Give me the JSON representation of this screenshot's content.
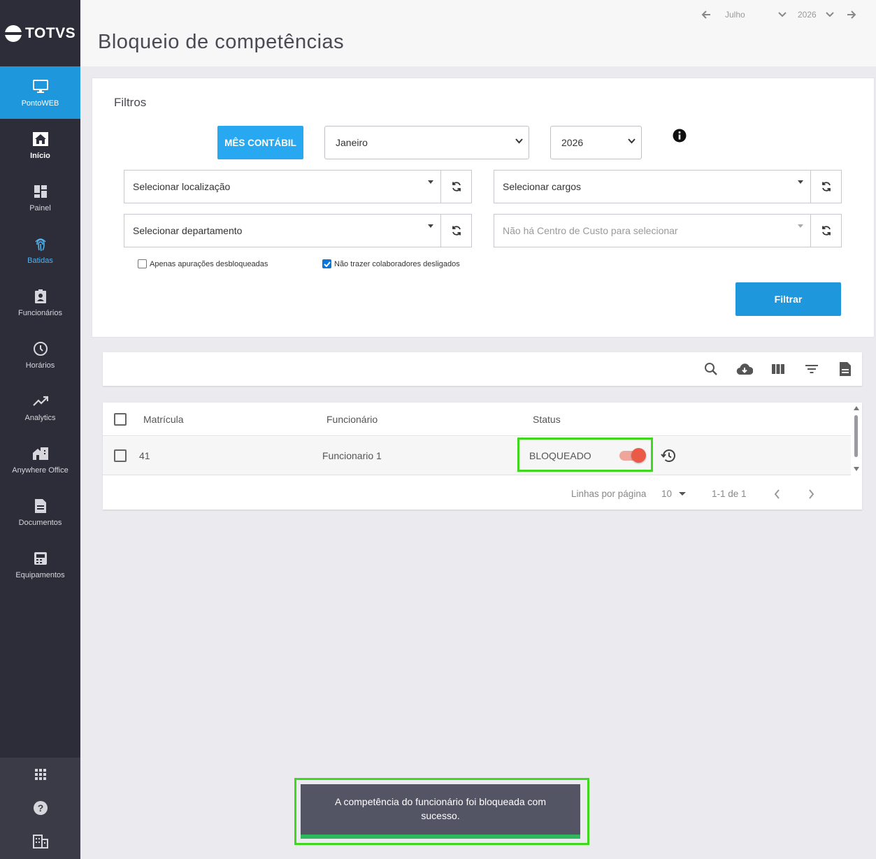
{
  "brand": {
    "logo_text": "TOTVS"
  },
  "sidebar": {
    "items": [
      {
        "label": "PontoWEB",
        "icon": "monitor-icon"
      },
      {
        "label": "Início",
        "icon": "home-icon"
      },
      {
        "label": "Painel",
        "icon": "dashboard-icon"
      },
      {
        "label": "Batidas",
        "icon": "fingerprint-icon"
      },
      {
        "label": "Funcionários",
        "icon": "badge-icon"
      },
      {
        "label": "Horários",
        "icon": "clock-icon"
      },
      {
        "label": "Analytics",
        "icon": "trending-up-icon"
      },
      {
        "label": "Anywhere Office",
        "icon": "home-work-icon"
      },
      {
        "label": "Documentos",
        "icon": "document-icon"
      },
      {
        "label": "Equipamentos",
        "icon": "device-icon"
      }
    ],
    "bottom": [
      "apps-grid-icon",
      "help-icon",
      "building-icon"
    ]
  },
  "header": {
    "title": "Bloqueio de competências",
    "period_month": "Julho",
    "period_year": "2026"
  },
  "filters": {
    "title": "Filtros",
    "mes_contabil_label": "MÊS CONTÁBIL",
    "month_value": "Janeiro",
    "year_value": "2026",
    "location_placeholder": "Selecionar localização",
    "cargos_placeholder": "Selecionar cargos",
    "departamento_placeholder": "Selecionar departamento",
    "centro_custo_placeholder": "Não há Centro de Custo para selecionar",
    "checkbox_unlocked_label": "Apenas apurações desbloqueadas",
    "checkbox_unlocked_checked": false,
    "checkbox_dismissed_label": "Não trazer colaboradores desligados",
    "checkbox_dismissed_checked": true,
    "filter_button": "Filtrar"
  },
  "table": {
    "columns": [
      "Matrícula",
      "Funcionário",
      "Status"
    ],
    "rows": [
      {
        "matricula": "41",
        "funcionario": "Funcionario 1",
        "status": "BLOQUEADO",
        "locked": true
      }
    ],
    "pager": {
      "rows_per_page_label": "Linhas por página",
      "rows_per_page": "10",
      "range": "1-1 de 1"
    }
  },
  "toast": {
    "message": "A competência do funcionário foi bloqueada com sucesso."
  },
  "colors": {
    "sidebar_bg": "#2c2d38",
    "accent": "#1f97dc",
    "highlight": "#3fd81e",
    "toggle_on": "#ea5a47",
    "toast_bg": "#545564",
    "toast_progress": "#2fb85d"
  }
}
